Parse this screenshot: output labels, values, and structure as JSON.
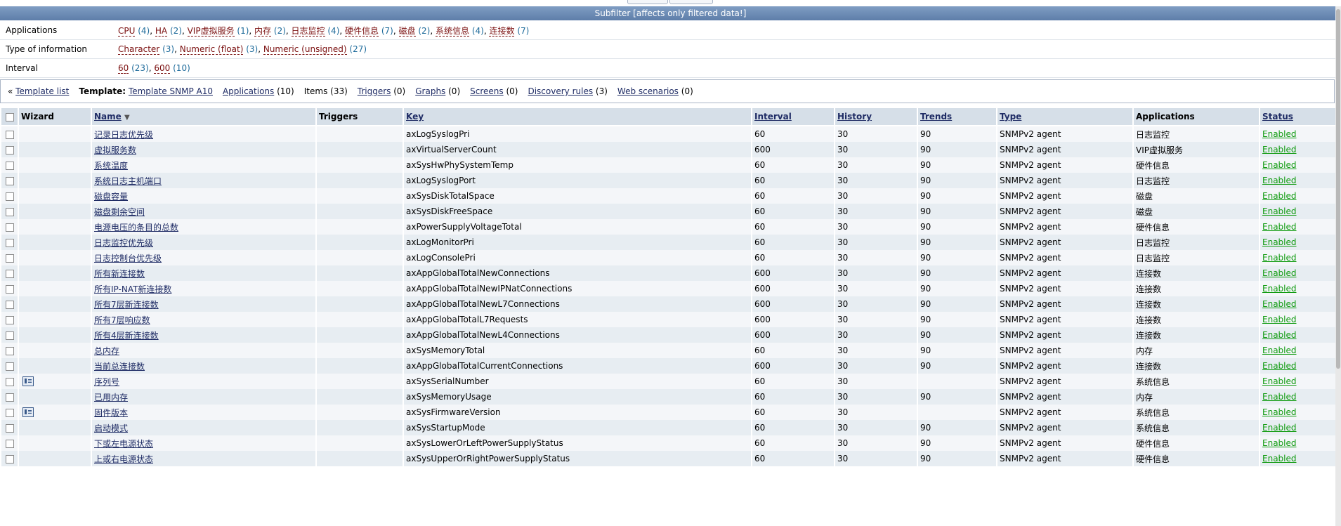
{
  "subfilter_title": "Subfilter [affects only filtered data!]",
  "filters": [
    {
      "label": "Applications",
      "items": [
        {
          "name": "CPU",
          "count": "(4)"
        },
        {
          "name": "HA",
          "count": "(2)"
        },
        {
          "name": "VIP虚拟服务",
          "count": "(1)"
        },
        {
          "name": "内存",
          "count": "(2)"
        },
        {
          "name": "日志监控",
          "count": "(4)"
        },
        {
          "name": "硬件信息",
          "count": "(7)"
        },
        {
          "name": "磁盘",
          "count": "(2)"
        },
        {
          "name": "系统信息",
          "count": "(4)"
        },
        {
          "name": "连接数",
          "count": "(7)"
        }
      ]
    },
    {
      "label": "Type of information",
      "items": [
        {
          "name": "Character",
          "count": "(3)"
        },
        {
          "name": "Numeric (float)",
          "count": "(3)"
        },
        {
          "name": "Numeric (unsigned)",
          "count": "(27)"
        }
      ]
    },
    {
      "label": "Interval",
      "items": [
        {
          "name": "60",
          "count": "(23)"
        },
        {
          "name": "600",
          "count": "(10)"
        }
      ]
    }
  ],
  "nav": {
    "back_prefix": "«",
    "template_list": "Template list",
    "template_label": "Template:",
    "template_name": "Template SNMP A10",
    "applications": "Applications",
    "applications_count": "(10)",
    "items": "Items (33)",
    "triggers": "Triggers",
    "triggers_count": "(0)",
    "graphs": "Graphs",
    "graphs_count": "(0)",
    "screens": "Screens",
    "screens_count": "(0)",
    "discovery": "Discovery rules",
    "discovery_count": "(3)",
    "web": "Web scenarios",
    "web_count": "(0)"
  },
  "table": {
    "headers": {
      "wizard": "Wizard",
      "name": "Name",
      "triggers": "Triggers",
      "key": "Key",
      "interval": "Interval",
      "history": "History",
      "trends": "Trends",
      "type": "Type",
      "applications": "Applications",
      "status": "Status"
    },
    "rows": [
      {
        "wizard": false,
        "name": "记录日志优先级",
        "key": "axLogSyslogPri",
        "interval": "60",
        "history": "30",
        "trends": "90",
        "type": "SNMPv2 agent",
        "app": "日志监控",
        "status": "Enabled"
      },
      {
        "wizard": false,
        "name": "虚拟服务数",
        "key": "axVirtualServerCount",
        "interval": "600",
        "history": "30",
        "trends": "90",
        "type": "SNMPv2 agent",
        "app": "VIP虚拟服务",
        "status": "Enabled"
      },
      {
        "wizard": false,
        "name": "系统温度",
        "key": "axSysHwPhySystemTemp",
        "interval": "60",
        "history": "30",
        "trends": "90",
        "type": "SNMPv2 agent",
        "app": "硬件信息",
        "status": "Enabled"
      },
      {
        "wizard": false,
        "name": "系统日志主机端口",
        "key": "axLogSyslogPort",
        "interval": "60",
        "history": "30",
        "trends": "90",
        "type": "SNMPv2 agent",
        "app": "日志监控",
        "status": "Enabled"
      },
      {
        "wizard": false,
        "name": "磁盘容量",
        "key": "axSysDiskTotalSpace",
        "interval": "60",
        "history": "30",
        "trends": "90",
        "type": "SNMPv2 agent",
        "app": "磁盘",
        "status": "Enabled"
      },
      {
        "wizard": false,
        "name": "磁盘剩余空间",
        "key": "axSysDiskFreeSpace",
        "interval": "60",
        "history": "30",
        "trends": "90",
        "type": "SNMPv2 agent",
        "app": "磁盘",
        "status": "Enabled"
      },
      {
        "wizard": false,
        "name": "电源电压的条目的总数",
        "key": "axPowerSupplyVoltageTotal",
        "interval": "60",
        "history": "30",
        "trends": "90",
        "type": "SNMPv2 agent",
        "app": "硬件信息",
        "status": "Enabled"
      },
      {
        "wizard": false,
        "name": "日志监控优先级",
        "key": "axLogMonitorPri",
        "interval": "60",
        "history": "30",
        "trends": "90",
        "type": "SNMPv2 agent",
        "app": "日志监控",
        "status": "Enabled"
      },
      {
        "wizard": false,
        "name": "日志控制台优先级",
        "key": "axLogConsolePri",
        "interval": "60",
        "history": "30",
        "trends": "90",
        "type": "SNMPv2 agent",
        "app": "日志监控",
        "status": "Enabled"
      },
      {
        "wizard": false,
        "name": "所有新连接数",
        "key": "axAppGlobalTotalNewConnections",
        "interval": "600",
        "history": "30",
        "trends": "90",
        "type": "SNMPv2 agent",
        "app": "连接数",
        "status": "Enabled"
      },
      {
        "wizard": false,
        "name": "所有IP-NAT新连接数",
        "key": "axAppGlobalTotalNewIPNatConnections",
        "interval": "600",
        "history": "30",
        "trends": "90",
        "type": "SNMPv2 agent",
        "app": "连接数",
        "status": "Enabled"
      },
      {
        "wizard": false,
        "name": "所有7层新连接数",
        "key": "axAppGlobalTotalNewL7Connections",
        "interval": "600",
        "history": "30",
        "trends": "90",
        "type": "SNMPv2 agent",
        "app": "连接数",
        "status": "Enabled"
      },
      {
        "wizard": false,
        "name": "所有7层响应数",
        "key": "axAppGlobalTotalL7Requests",
        "interval": "600",
        "history": "30",
        "trends": "90",
        "type": "SNMPv2 agent",
        "app": "连接数",
        "status": "Enabled"
      },
      {
        "wizard": false,
        "name": "所有4层新连接数",
        "key": "axAppGlobalTotalNewL4Connections",
        "interval": "600",
        "history": "30",
        "trends": "90",
        "type": "SNMPv2 agent",
        "app": "连接数",
        "status": "Enabled"
      },
      {
        "wizard": false,
        "name": "总内存",
        "key": "axSysMemoryTotal",
        "interval": "60",
        "history": "30",
        "trends": "90",
        "type": "SNMPv2 agent",
        "app": "内存",
        "status": "Enabled"
      },
      {
        "wizard": false,
        "name": "当前总连接数",
        "key": "axAppGlobalTotalCurrentConnections",
        "interval": "600",
        "history": "30",
        "trends": "90",
        "type": "SNMPv2 agent",
        "app": "连接数",
        "status": "Enabled"
      },
      {
        "wizard": true,
        "name": "序列号",
        "key": "axSysSerialNumber",
        "interval": "60",
        "history": "30",
        "trends": "",
        "type": "SNMPv2 agent",
        "app": "系统信息",
        "status": "Enabled"
      },
      {
        "wizard": false,
        "name": "已用内存",
        "key": "axSysMemoryUsage",
        "interval": "60",
        "history": "30",
        "trends": "90",
        "type": "SNMPv2 agent",
        "app": "内存",
        "status": "Enabled"
      },
      {
        "wizard": true,
        "name": "固件版本",
        "key": "axSysFirmwareVersion",
        "interval": "60",
        "history": "30",
        "trends": "",
        "type": "SNMPv2 agent",
        "app": "系统信息",
        "status": "Enabled"
      },
      {
        "wizard": false,
        "name": "启动模式",
        "key": "axSysStartupMode",
        "interval": "60",
        "history": "30",
        "trends": "90",
        "type": "SNMPv2 agent",
        "app": "系统信息",
        "status": "Enabled"
      },
      {
        "wizard": false,
        "name": "下或左电源状态",
        "key": "axSysLowerOrLeftPowerSupplyStatus",
        "interval": "60",
        "history": "30",
        "trends": "90",
        "type": "SNMPv2 agent",
        "app": "硬件信息",
        "status": "Enabled"
      },
      {
        "wizard": false,
        "name": "上或右电源状态",
        "key": "axSysUpperOrRightPowerSupplyStatus",
        "interval": "60",
        "history": "30",
        "trends": "90",
        "type": "SNMPv2 agent",
        "app": "硬件信息",
        "status": "Enabled"
      }
    ]
  }
}
